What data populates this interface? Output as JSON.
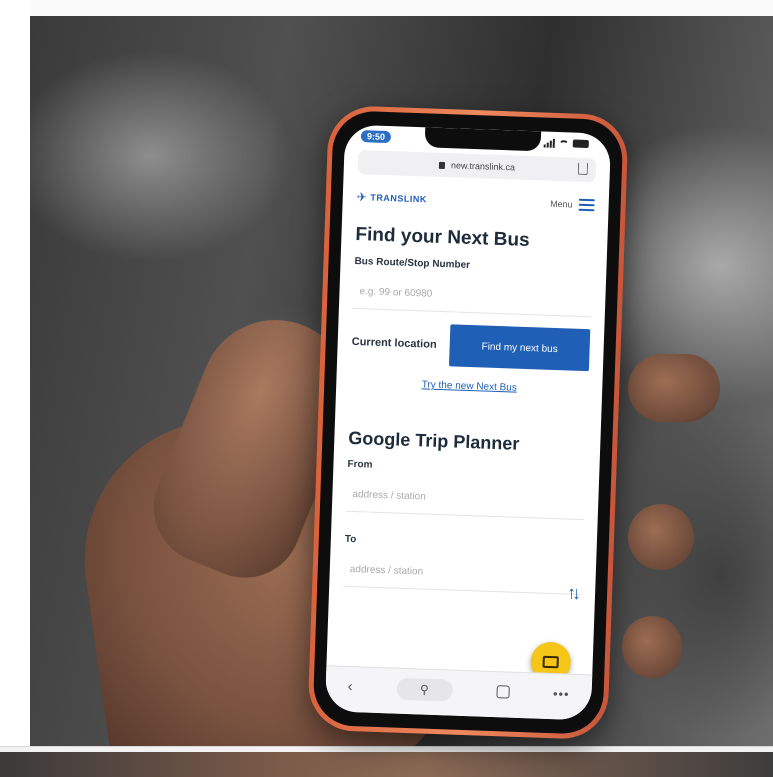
{
  "status": {
    "time": "9:50"
  },
  "browser": {
    "url": "new.translink.ca",
    "back_glyph": "‹",
    "search_glyph": "⚲",
    "more_glyph": "•••"
  },
  "site": {
    "logo_text": "TRANSLINK",
    "menu_label": "Menu"
  },
  "next_bus": {
    "title": "Find your Next Bus",
    "route_label": "Bus Route/Stop Number",
    "route_placeholder": "e.g. 99 or 60980",
    "location_label": "Current location",
    "find_button": "Find my next bus",
    "new_link": "Try the new Next Bus"
  },
  "trip_planner": {
    "title": "Google Trip Planner",
    "from_label": "From",
    "from_placeholder": "address / station",
    "to_label": "To",
    "to_placeholder": "address / station",
    "swap_glyph": "↑↓"
  },
  "colors": {
    "brand_blue": "#1f5fb6",
    "fab_yellow": "#f5c518",
    "phone_frame": "#e57a52"
  }
}
